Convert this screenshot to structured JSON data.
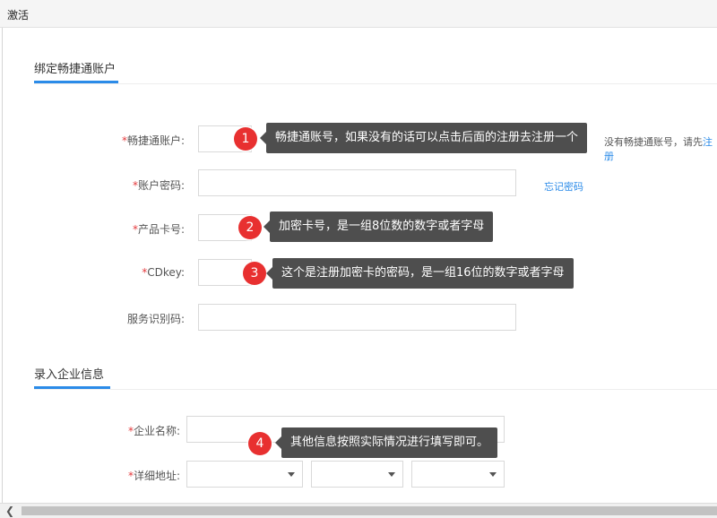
{
  "window": {
    "title": "激活"
  },
  "sections": {
    "bind": {
      "title": "绑定畅捷通账户"
    },
    "company": {
      "title": "录入企业信息"
    }
  },
  "fields": {
    "account": {
      "required": "*",
      "label": "畅捷通账户:",
      "value": ""
    },
    "password": {
      "required": "*",
      "label": "账户密码:",
      "value": ""
    },
    "card": {
      "required": "*",
      "label": "产品卡号:",
      "value": ""
    },
    "cdkey": {
      "required": "*",
      "label": "CDkey:",
      "value": ""
    },
    "service_code": {
      "required": "",
      "label": "服务识别码:",
      "value": ""
    },
    "company_name": {
      "required": "*",
      "label": "企业名称:",
      "value": ""
    },
    "address": {
      "required": "*",
      "label": "详细地址:",
      "province": "",
      "city": "",
      "district": ""
    }
  },
  "links": {
    "account_hint": "没有畅捷通账号，请先",
    "register": "注册",
    "forgot_password": "忘记密码"
  },
  "tips": [
    {
      "number": "1",
      "text": "畅捷通账号，如果没有的话可以点击后面的注册去注册一个"
    },
    {
      "number": "2",
      "text": "加密卡号，是一组8位数的数字或者字母"
    },
    {
      "number": "3",
      "text": "这个是注册加密卡的密码，是一组16位的数字或者字母"
    },
    {
      "number": "4",
      "text": "其他信息按照实际情况进行填写即可。"
    }
  ],
  "icons": {
    "scroll_left": "chevron-left-icon",
    "select_caret": "caret-down-icon"
  },
  "colors": {
    "accent": "#2b8be8",
    "required": "#e4393c",
    "tip_badge": "#e83030",
    "tip_bubble": "#4e4e4e"
  }
}
